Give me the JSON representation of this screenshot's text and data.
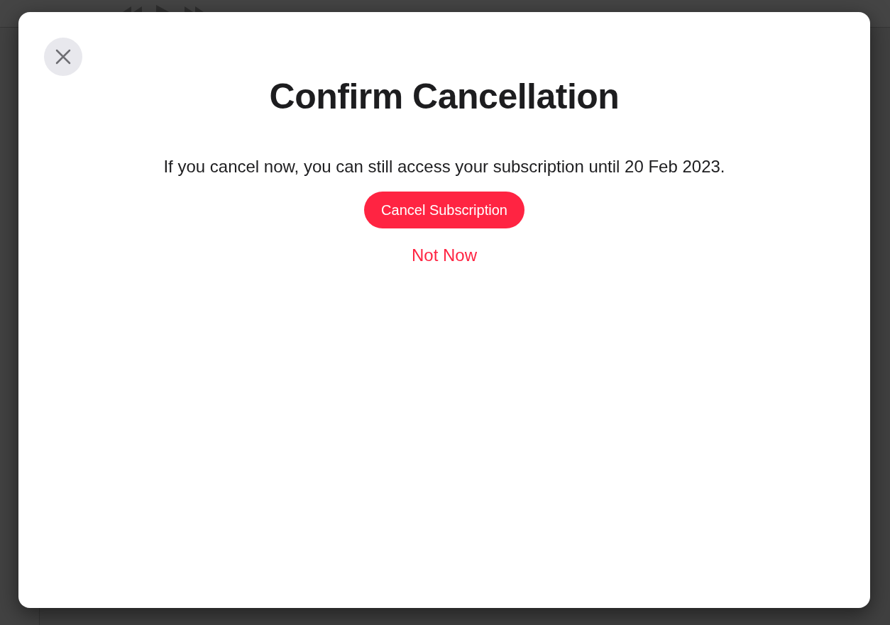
{
  "dialog": {
    "title": "Confirm Cancellation",
    "message": "If you cancel now, you can still access your subscription until 20 Feb 2023.",
    "primary_button": "Cancel Subscription",
    "secondary_button": "Not Now"
  }
}
